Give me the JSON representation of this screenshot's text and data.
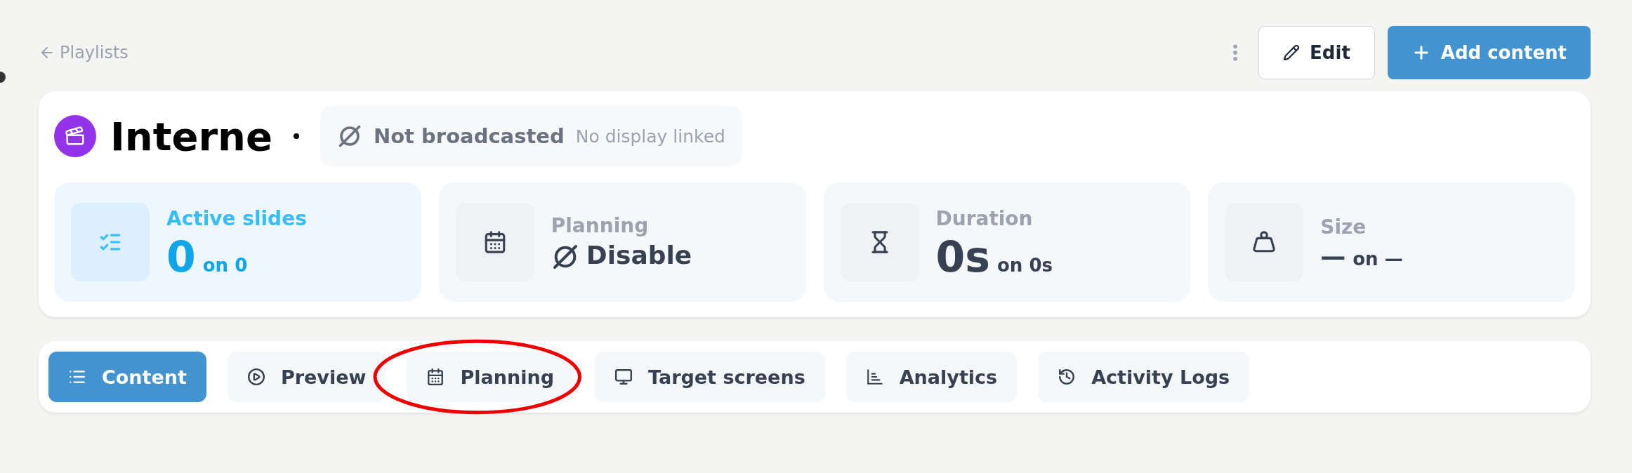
{
  "back_link": {
    "label": "Playlists"
  },
  "actions": [
    {
      "kind": "edit",
      "label": "Edit",
      "primary": false
    },
    {
      "kind": "add",
      "label": "Add content",
      "primary": true
    }
  ],
  "playlist": {
    "title": "Interne",
    "status": "Not broadcasted",
    "display": "No display linked"
  },
  "stats": [
    {
      "kind": "list",
      "label": "Active slides",
      "value": "0",
      "sub": "on 0",
      "highlighted": true
    },
    {
      "kind": "calendar",
      "label": "Planning",
      "value": "Disable",
      "highlighted": false
    },
    {
      "kind": "hourglass",
      "label": "Duration",
      "value": "0s",
      "sub": "on 0s",
      "highlighted": false
    },
    {
      "kind": "weight",
      "label": "Size",
      "value": "—",
      "sub": "on —",
      "highlighted": false
    }
  ],
  "tabs": [
    {
      "kind": "list",
      "label": "Content",
      "selected": true,
      "circled": false
    },
    {
      "kind": "play",
      "label": "Preview",
      "selected": false,
      "circled": false
    },
    {
      "kind": "calendar",
      "label": "Planning",
      "selected": false,
      "circled": true
    },
    {
      "kind": "monitor",
      "label": "Target screens",
      "selected": false,
      "circled": false
    },
    {
      "kind": "chart",
      "label": "Analytics",
      "selected": false,
      "circled": false
    },
    {
      "kind": "history",
      "label": "Activity Logs",
      "selected": false,
      "circled": false
    }
  ]
}
